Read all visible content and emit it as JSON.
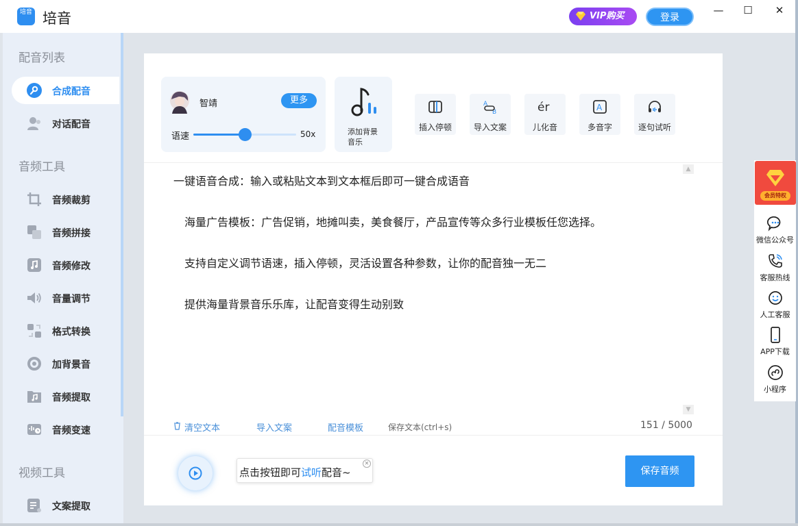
{
  "app": {
    "title": "培音",
    "logo_text": "培音"
  },
  "header": {
    "vip_label": "VIP购买",
    "login_label": "登录"
  },
  "window_controls": {
    "minimize": "—",
    "maximize": "☐",
    "close": "✕"
  },
  "sidebar": {
    "sections": [
      {
        "title": "配音列表",
        "items": [
          {
            "label": "合成配音",
            "icon": "voice-synthesis-icon",
            "active": true
          },
          {
            "label": "对话配音",
            "icon": "dialogue-icon"
          }
        ]
      },
      {
        "title": "音频工具",
        "items": [
          {
            "label": "音频裁剪",
            "icon": "crop-icon"
          },
          {
            "label": "音频拼接",
            "icon": "merge-icon"
          },
          {
            "label": "音频修改",
            "icon": "music-note-icon"
          },
          {
            "label": "音量调节",
            "icon": "volume-icon"
          },
          {
            "label": "格式转换",
            "icon": "format-convert-icon"
          },
          {
            "label": "加背景音",
            "icon": "background-music-icon"
          },
          {
            "label": "音频提取",
            "icon": "audio-extract-icon"
          },
          {
            "label": "音频变速",
            "icon": "speed-change-icon"
          }
        ]
      },
      {
        "title": "视频工具",
        "items": [
          {
            "label": "文案提取",
            "icon": "text-extract-icon"
          }
        ]
      }
    ]
  },
  "voice": {
    "name": "智靖",
    "more_label": "更多",
    "speed_label": "语速",
    "speed_value": "50x",
    "speed_fraction": 0.5
  },
  "bgm": {
    "label": "添加背景音乐"
  },
  "tools": [
    {
      "label": "插入停顿",
      "icon": "pause-insert-icon"
    },
    {
      "label": "导入文案",
      "icon": "import-text-icon",
      "icon_text": "AB"
    },
    {
      "label": "儿化音",
      "icon": "erhua-icon",
      "icon_text": "ér"
    },
    {
      "label": "多音字",
      "icon": "polyphone-icon",
      "icon_text": "A"
    },
    {
      "label": "逐句试听",
      "icon": "headphones-icon"
    }
  ],
  "editor": {
    "lines": [
      "一键语音合成：输入或粘贴文本到文本框后即可一键合成语音",
      "海量广告模板：广告促销，地摊叫卖，美食餐厅，产品宣传等众多行业模板任您选择。",
      "支持自定义调节语速，插入停顿，灵活设置各种参数，让你的配音独一无二",
      "提供海量背景音乐乐库，让配音变得生动别致"
    ],
    "clear_label": "清空文本",
    "import_label": "导入文案",
    "template_label": "配音模板",
    "save_text_label": "保存文本(ctrl+s)",
    "char_count": "151 / 5000"
  },
  "player": {
    "tip_prefix": "点击按钮即可",
    "tip_highlight": "试听",
    "tip_suffix": "配音~",
    "save_audio_label": "保存音频"
  },
  "float_panel": {
    "promo_label": "会员特权",
    "items": [
      {
        "label": "微信公众号",
        "icon": "wechat-icon"
      },
      {
        "label": "客服热线",
        "icon": "phone-icon"
      },
      {
        "label": "人工客服",
        "icon": "service-icon"
      },
      {
        "label": "APP下载",
        "icon": "mobile-icon"
      },
      {
        "label": "小程序",
        "icon": "mini-program-icon"
      }
    ]
  },
  "colors": {
    "accent": "#2e8ef0",
    "vip": "#8a44f1",
    "promo": "#f04a3e",
    "sidebar_bg": "#e9eff8"
  }
}
